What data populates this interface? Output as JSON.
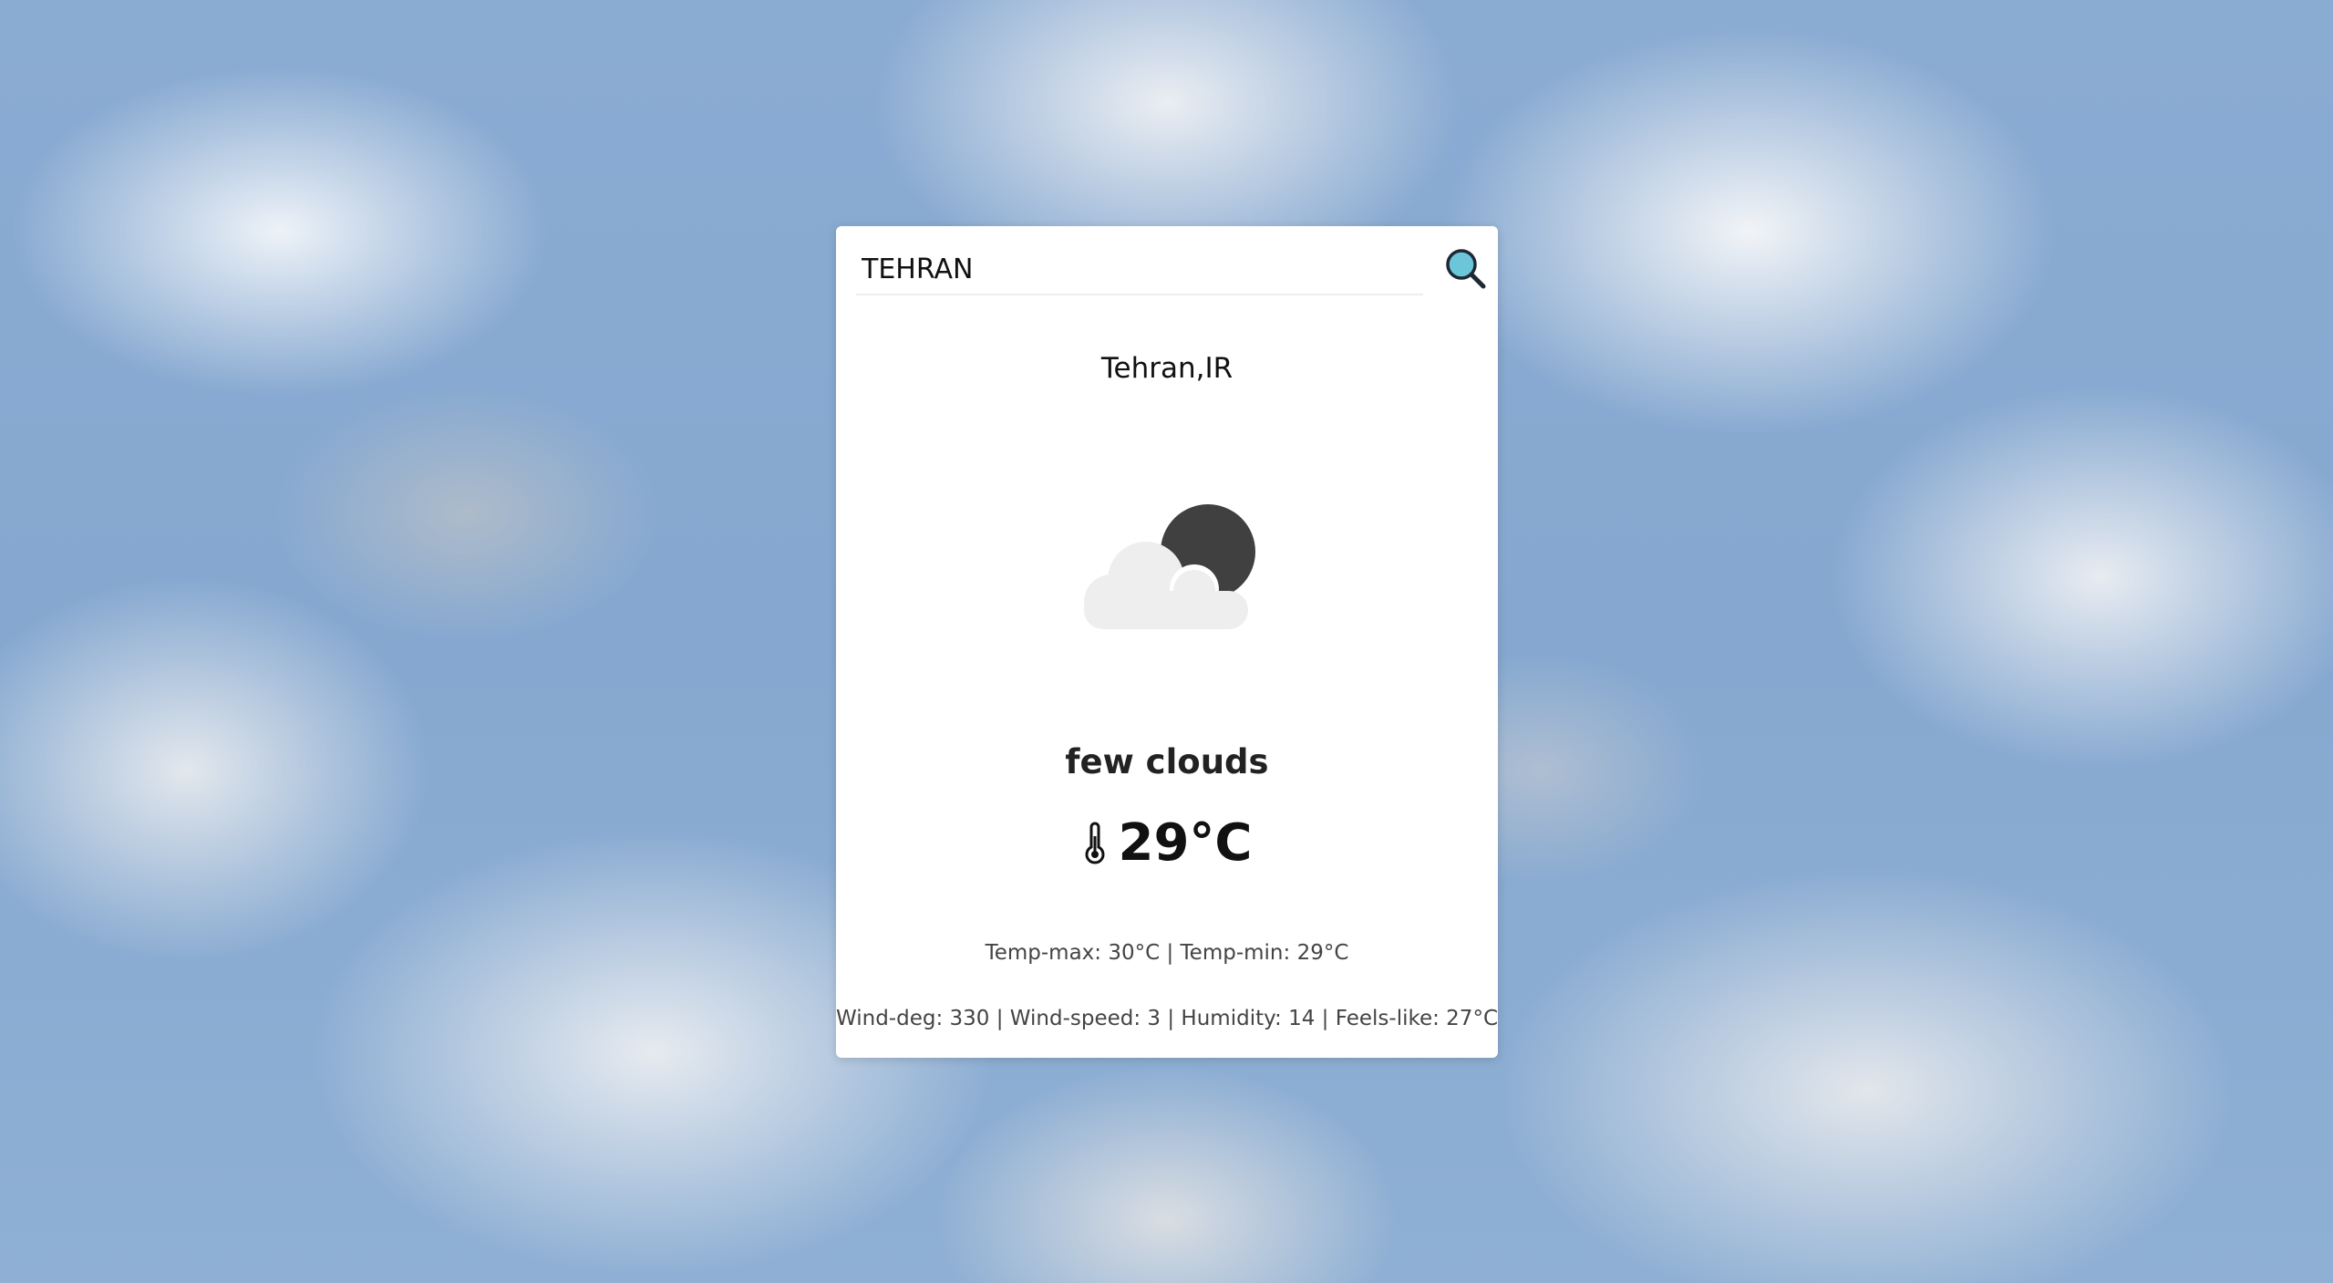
{
  "search": {
    "value": "TEHRAN",
    "icon": "search-icon"
  },
  "weather": {
    "location": "Tehran,IR",
    "icon": "partly-cloudy-night-icon",
    "description": "few clouds",
    "temperature": "29°C",
    "temp_max": "30°C",
    "temp_min": "29°C",
    "wind_deg": "330",
    "wind_speed": "3",
    "humidity": "14",
    "feels_like": "27°C"
  },
  "labels": {
    "minmax": "Temp-max: 30°C | Temp-min: 29°C",
    "details": "Wind-deg: 330 | Wind-speed: 3 | Humidity: 14 | Feels-like: 27°C"
  },
  "colors": {
    "search_icon_fill": "#6cc6d9",
    "moon": "#404040",
    "cloud": "#eeeeee"
  }
}
